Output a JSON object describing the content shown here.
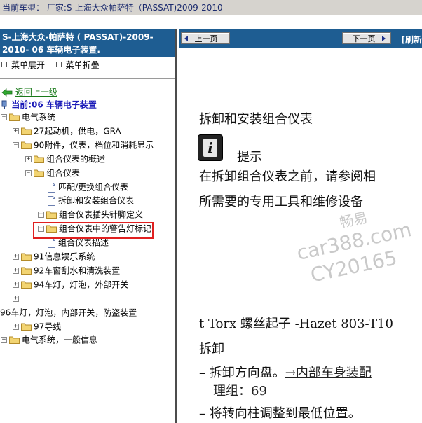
{
  "topbar": {
    "text": "当前车型：  厂家:S-上海大众帕萨特（PASSAT)2009-2010"
  },
  "left": {
    "header": "S-上海大众-帕萨特 ( PASSAT)-2009-2010- 06 车辆电子装置.",
    "expand_label": "菜单展开",
    "collapse_label": "菜单折叠",
    "back_label": "返回上一级",
    "current_label": "当前:06 车辆电子装置",
    "tree": [
      {
        "label": "电气系统",
        "toggle": "−",
        "icon": "folder"
      },
      {
        "label": "27起动机，供电，GRA",
        "toggle": "+",
        "icon": "folder"
      },
      {
        "label": "90附件，仪表，档位和消耗显示",
        "toggle": "−",
        "icon": "folder"
      },
      {
        "label": "组合仪表的概述",
        "toggle": "+",
        "icon": "folder"
      },
      {
        "label": "组合仪表",
        "toggle": "−",
        "icon": "folder"
      },
      {
        "label": "匹配/更换组合仪表",
        "toggle": "",
        "icon": "page"
      },
      {
        "label": "拆卸和安装组合仪表",
        "toggle": "",
        "icon": "page"
      },
      {
        "label": "组合仪表插头针脚定义",
        "toggle": "+",
        "icon": "folder"
      },
      {
        "label": "组合仪表中的警告灯标记",
        "toggle": "+",
        "icon": "folder"
      },
      {
        "label": "组合仪表描述",
        "toggle": "",
        "icon": "page"
      },
      {
        "label": "91信息娱乐系统",
        "toggle": "+",
        "icon": "folder"
      },
      {
        "label": "92车窗刮水和清洗装置",
        "toggle": "+",
        "icon": "folder"
      },
      {
        "label": "94车灯，灯泡，外部开关",
        "toggle": "+",
        "icon": "folder"
      },
      {
        "label": "",
        "toggle": "+",
        "icon": ""
      },
      {
        "label": "96车灯，灯泡，内部开关，防盗装置",
        "toggle": "",
        "icon": ""
      },
      {
        "label": "97导线",
        "toggle": "+",
        "icon": "folder"
      },
      {
        "label": "电气系统，一般信息",
        "toggle": "+",
        "icon": "folder"
      }
    ]
  },
  "nav": {
    "prev_label": "上一页",
    "next_label": "下一页",
    "refresh_label": "[刷新"
  },
  "doc": {
    "title": "拆卸和安装组合仪表",
    "tip_label": "提示",
    "tip_line1": "在拆卸组合仪表之前，请参阅相",
    "tip_line2": "所需要的专用工具和维修设备",
    "tool_line": "t Torx 螺丝起子 -Hazet 803-T10",
    "section_remove": "拆卸",
    "step1_text": "– 拆卸方向盘。",
    "step1_link": "→内部车身装配",
    "step1_link2": "理组：69",
    "step2_text": "– 将转向柱调整到最低位置。"
  },
  "watermark": {
    "line1": "畅易",
    "line2": "car388.com",
    "line3": "CY20165"
  },
  "colors": {
    "header_blue": "#1e5d92",
    "highlight_red": "#e02020",
    "link_green": "#1a7a1a",
    "current_blue": "#1b1bb8"
  }
}
